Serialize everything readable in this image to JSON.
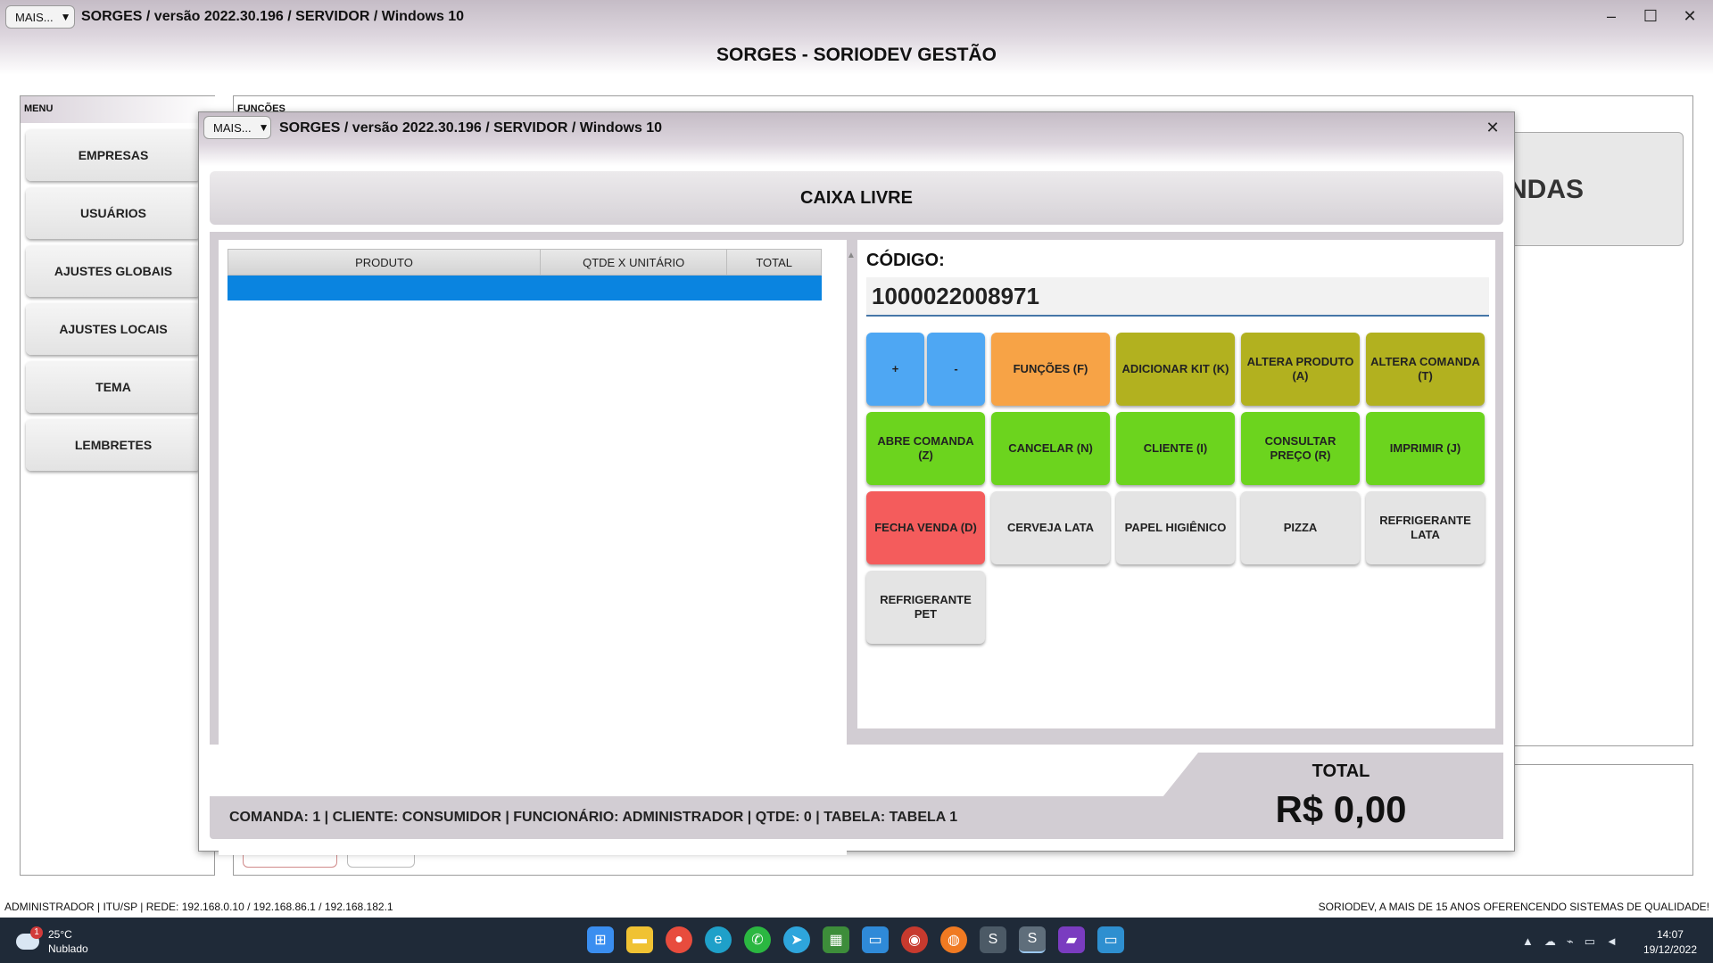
{
  "window": {
    "mais_label": "MAIS...",
    "title": "SORGES / versão 2022.30.196 / SERVIDOR / Windows 10",
    "minimize": "–",
    "maximize": "☐",
    "close": "✕",
    "app_title": "SORGES - SORIODEV GESTÃO"
  },
  "menu": {
    "label": "MENU",
    "items": [
      {
        "label": "EMPRESAS"
      },
      {
        "label": "USUÁRIOS"
      },
      {
        "label": "AJUSTES GLOBAIS"
      },
      {
        "label": "AJUSTES LOCAIS"
      },
      {
        "label": "TEMA"
      },
      {
        "label": "LEMBRETES"
      }
    ]
  },
  "functions_panel": {
    "label": "FUNÇÕES",
    "vendas_fragment": "NDAS"
  },
  "modal": {
    "mais_label": "MAIS...",
    "title": "SORGES / versão 2022.30.196 / SERVIDOR / Windows 10",
    "close": "✕",
    "caixa_status": "CAIXA LIVRE",
    "grid": {
      "columns": [
        "PRODUTO",
        "QTDE X UNITÁRIO",
        "TOTAL"
      ]
    },
    "codigo_label": "CÓDIGO:",
    "codigo_value": "1000022008971",
    "keys": {
      "plus": "+",
      "minus": "-",
      "funcoes": "FUNÇÕES (F)",
      "adicionar_kit": "ADICIONAR KIT (K)",
      "altera_produto": "ALTERA PRODUTO (A)",
      "altera_comanda": "ALTERA COMANDA (T)",
      "abre_comanda": "ABRE COMANDA (Z)",
      "cancelar": "CANCELAR (N)",
      "cliente": "CLIENTE (I)",
      "consultar_preco": "CONSULTAR PREÇO (R)",
      "imprimir": "IMPRIMIR (J)",
      "fecha_venda": "FECHA VENDA (D)",
      "cerveja_lata": "CERVEJA LATA",
      "papel_higienico": "PAPEL HIGIÊNICO",
      "pizza": "PIZZA",
      "refrigerante_lata": "REFRIGERANTE LATA",
      "refrigerante_pet": "REFRIGERANTE PET"
    },
    "footer_info": "COMANDA: 1  |  CLIENTE: CONSUMIDOR  |  FUNCIONÁRIO: ADMINISTRADOR  |  QTDE: 0  |  TABELA: TABELA 1",
    "total_label": "TOTAL",
    "total_value": "R$ 0,00"
  },
  "statusbar": {
    "left": "ADMINISTRADOR |   ITU/SP |   REDE: 192.168.0.10 / 192.168.86.1 / 192.168.182.1",
    "right": "SORIODEV, A MAIS DE 15 ANOS OFERENCENDO SISTEMAS DE QUALIDADE!"
  },
  "taskbar": {
    "weather_badge": "1",
    "temperature": "25°C",
    "condition": "Nublado",
    "time": "14:07",
    "date": "19/12/2022"
  },
  "colors": {
    "blue_key": "#4ea7f3",
    "orange_key": "#f7a346",
    "olive_key": "#b2b11f",
    "green_key": "#6cd41e",
    "red_key": "#f45c5c",
    "selected_row": "#0a84e0"
  }
}
